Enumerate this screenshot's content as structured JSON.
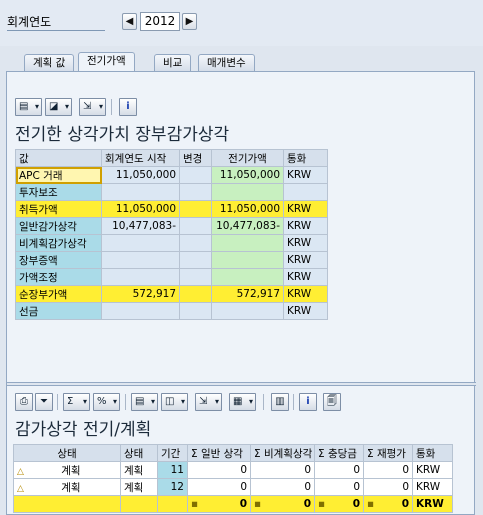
{
  "header": {
    "fiscal_year_label": "회계연도",
    "fiscal_year_value": "2012",
    "prev_symbol": "◀",
    "next_symbol": "▶"
  },
  "tabs": [
    {
      "label": "계획 값",
      "active": false
    },
    {
      "label": "전기가액",
      "active": true
    },
    {
      "label": "비교",
      "active": false
    },
    {
      "label": "매개변수",
      "active": false
    }
  ],
  "toolbar_icons": [
    "print-icon",
    "layout-icon",
    "export-icon",
    "info-icon"
  ],
  "upper": {
    "title": "전기한 상각가치 장부감가상각",
    "columns": [
      "값",
      "회계연도 시작",
      "변경",
      "전기가액",
      "통화"
    ],
    "rows": [
      {
        "label": "APC 거래",
        "start": "11,050,000",
        "change": "",
        "posted": "11,050,000",
        "currency": "KRW",
        "highlight": false,
        "selected": true
      },
      {
        "label": "투자보조",
        "start": "",
        "change": "",
        "posted": "",
        "currency": "",
        "highlight": false,
        "selected": false
      },
      {
        "label": "취득가액",
        "start": "11,050,000",
        "change": "",
        "posted": "11,050,000",
        "currency": "KRW",
        "highlight": true,
        "selected": false
      },
      {
        "label": "일반감가상각",
        "start": "10,477,083-",
        "change": "",
        "posted": "10,477,083-",
        "currency": "KRW",
        "highlight": false,
        "selected": false
      },
      {
        "label": "비계획감가상각",
        "start": "",
        "change": "",
        "posted": "",
        "currency": "KRW",
        "highlight": false,
        "selected": false
      },
      {
        "label": "장부증액",
        "start": "",
        "change": "",
        "posted": "",
        "currency": "KRW",
        "highlight": false,
        "selected": false
      },
      {
        "label": "가액조정",
        "start": "",
        "change": "",
        "posted": "",
        "currency": "KRW",
        "highlight": false,
        "selected": false
      },
      {
        "label": "순장부가액",
        "start": "572,917",
        "change": "",
        "posted": "572,917",
        "currency": "KRW",
        "highlight": true,
        "selected": false
      },
      {
        "label": "선금",
        "start": "",
        "change": "",
        "posted": "",
        "currency": "KRW",
        "highlight": false,
        "selected": false
      }
    ]
  },
  "lower": {
    "title": "감가상각 전기/계획",
    "columns": [
      "상태",
      "상태",
      "기간",
      "Σ 일반 상각",
      "Σ 비계획상각",
      "Σ 충당금",
      "Σ 재평가",
      "통화"
    ],
    "rows": [
      {
        "icon": "△",
        "status": "계획",
        "status2": "계획",
        "period": "11",
        "ordinary": "0",
        "unplanned": "0",
        "reserve": "0",
        "reval": "0",
        "currency": "KRW"
      },
      {
        "icon": "△",
        "status": "계획",
        "status2": "계획",
        "period": "12",
        "ordinary": "0",
        "unplanned": "0",
        "reserve": "0",
        "reval": "0",
        "currency": "KRW"
      }
    ],
    "total": {
      "dot": "▪",
      "ordinary": "0",
      "unplanned": "0",
      "reserve": "0",
      "reval": "0",
      "currency": "KRW"
    }
  },
  "colors": {
    "accent_yellow": "#ffee33",
    "row_header": "#aadbe8",
    "posted_green": "#c8f0c0"
  }
}
